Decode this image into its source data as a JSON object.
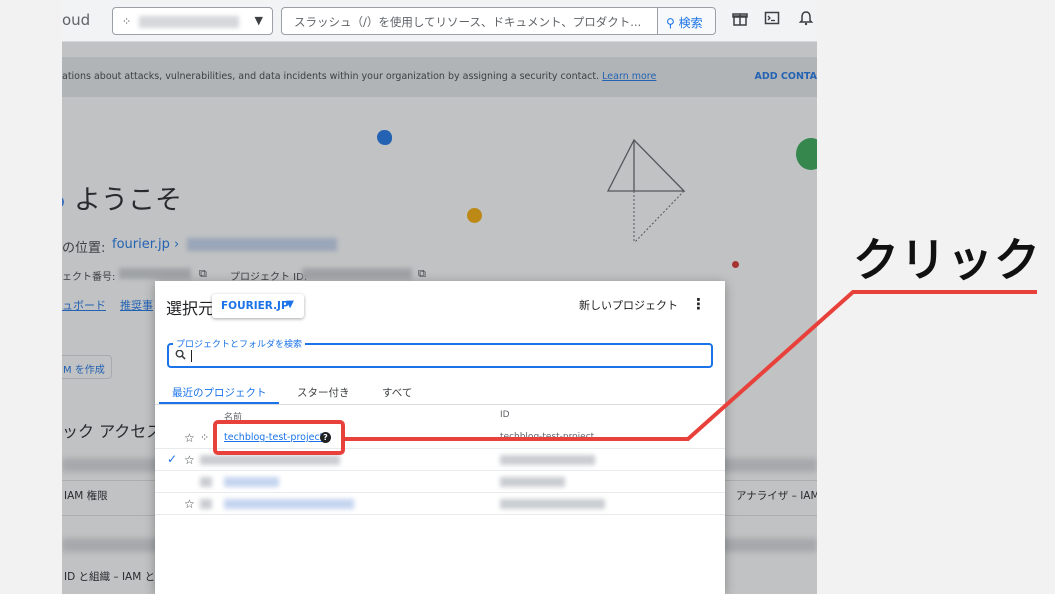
{
  "topbar": {
    "brand_fragment": "oud",
    "search_placeholder": "スラッシュ（/）を使用してリソース、ドキュメント、プロダクト...",
    "search_button": "検索",
    "icons": [
      "gift-icon",
      "terminal-icon",
      "bell-icon"
    ]
  },
  "banner": {
    "text": "ations about attacks, vulnerabilities, and data incidents within your organization by assigning a security contact.",
    "link": "Learn more",
    "action": "ADD CONTA"
  },
  "welcome": {
    "title": "ようこそ",
    "location_label": "の位置:",
    "location_link": "fourier.jp",
    "location_chevron": "›",
    "project_number_label": "ェクト番号:",
    "project_id_label": "プロジェクト ID:",
    "dashboard_link": "ュボード",
    "recommend_link": "推奨事",
    "create_button": "M を作成",
    "quick_access_title": "ック アクセス",
    "rows": [
      {
        "left": "IAM 権限",
        "right": "アナライザ – IAM"
      },
      {
        "left": "ID と組織 – IAM と"
      }
    ]
  },
  "dialog": {
    "title": "選択元",
    "org_selector": "FOURIER.JP",
    "new_project": "新しいプロジェクト",
    "search_label": "プロジェクトとフォルダを検索",
    "tabs": [
      {
        "label": "最近のプロジェクト",
        "active": true
      },
      {
        "label": "スター付き",
        "active": false
      },
      {
        "label": "すべて",
        "active": false
      }
    ],
    "columns": {
      "name": "名前",
      "id": "ID"
    },
    "rows": [
      {
        "name": "techblog-test-project",
        "id": "techblog-test-project",
        "starred": false,
        "selected": false
      }
    ]
  },
  "annotation": {
    "label": "クリック",
    "color": "#e8413b"
  },
  "colors": {
    "accent": "#1a73e8",
    "annotation_red": "#e8413b"
  }
}
